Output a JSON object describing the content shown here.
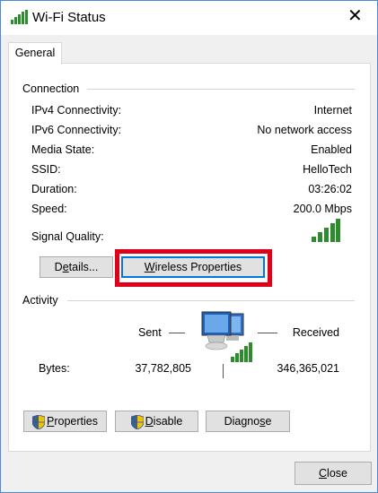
{
  "window": {
    "title": "Wi-Fi Status"
  },
  "tabs": [
    {
      "label": "General"
    }
  ],
  "connection": {
    "title": "Connection",
    "rows": [
      {
        "label": "IPv4 Connectivity:",
        "value": "Internet"
      },
      {
        "label": "IPv6 Connectivity:",
        "value": "No network access"
      },
      {
        "label": "Media State:",
        "value": "Enabled"
      },
      {
        "label": "SSID:",
        "value": "HelloTech"
      },
      {
        "label": "Duration:",
        "value": "03:26:02"
      },
      {
        "label": "Speed:",
        "value": "200.0 Mbps"
      }
    ],
    "signal_label": "Signal Quality:",
    "signal_bars": 5,
    "details_prefix": "D",
    "details_accel": "e",
    "details_rest": "tails...",
    "wireless_accel": "W",
    "wireless_rest": "ireless Properties"
  },
  "activity": {
    "title": "Activity",
    "sent_label": "Sent",
    "received_label": "Received",
    "bytes_label": "Bytes:",
    "bytes_sent": "37,782,805",
    "bytes_received": "346,365,021"
  },
  "buttons": {
    "properties_accel": "P",
    "properties_rest": "roperties",
    "disable_accel": "D",
    "disable_rest": "isable",
    "diagnose_prefix": "Diagno",
    "diagnose_accel": "s",
    "diagnose_rest": "e",
    "close_accel": "C",
    "close_rest": "lose"
  },
  "colors": {
    "highlight": "#e0001b",
    "signal": "#2e8b2e",
    "accent": "#0078d7"
  },
  "icons": {
    "window": "wifi-signal-icon",
    "close": "close-icon",
    "network": "network-computers-icon",
    "shield": "uac-shield-icon"
  }
}
